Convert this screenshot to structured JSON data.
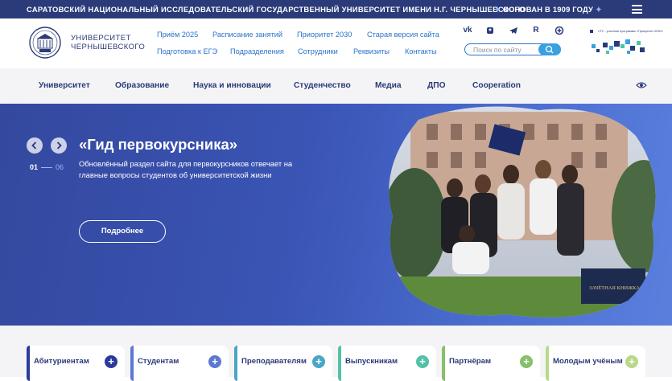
{
  "topbar": {
    "university_full": "САРАТОВСКИЙ НАЦИОНАЛЬНЫЙ ИССЛЕДОВАТЕЛЬСКИЙ ГОСУДАРСТВЕННЫЙ УНИВЕРСИТЕТ ИМЕНИ Н.Г. ЧЕРНЫШЕВСКОГО",
    "founded": "ОСНОВАН В 1909 ГОДУ"
  },
  "header": {
    "logo_line1": "УНИВЕРСИТЕТ",
    "logo_line2": "ЧЕРНЫШЕВСКОГО",
    "quick_links_row1": [
      "Приём 2025",
      "Расписание занятий",
      "Приоритет 2030",
      "Старая версия сайта"
    ],
    "quick_links_row2": [
      "Подготовка к ЕГЭ",
      "Подразделения",
      "Сотрудники",
      "Реквизиты",
      "Контакты"
    ],
    "socials": [
      "vk-icon",
      "ok-icon",
      "telegram-icon",
      "rutube-icon",
      "more-icon"
    ],
    "search_placeholder": "Поиск по сайту",
    "badge_text": "СГУ - участник программы «Приоритет-2030»"
  },
  "nav": {
    "items": [
      "Университет",
      "Образование",
      "Наука и инновации",
      "Студенчество",
      "Медиа",
      "ДПО",
      "Cooperation"
    ]
  },
  "hero": {
    "slide_current": "01",
    "slide_total": "06",
    "title": "«Гид первокурсника»",
    "description": "Обновлённый раздел сайта для первокурсников отвечает на главные вопросы студентов об университетской жизни",
    "more_button": "Подробнее",
    "photo_book_label": "ЗАЧЁТНАЯ КНИЖКА"
  },
  "audience": [
    {
      "label": "Абитуриентам",
      "color": "#2b3a9b"
    },
    {
      "label": "Студентам",
      "color": "#5b79d1"
    },
    {
      "label": "Преподавателям",
      "color": "#4ba6c6"
    },
    {
      "label": "Выпускникам",
      "color": "#52c2a6"
    },
    {
      "label": "Партнёрам",
      "color": "#86c06a"
    },
    {
      "label": "Молодым учёным",
      "color": "#b9d98a"
    }
  ]
}
